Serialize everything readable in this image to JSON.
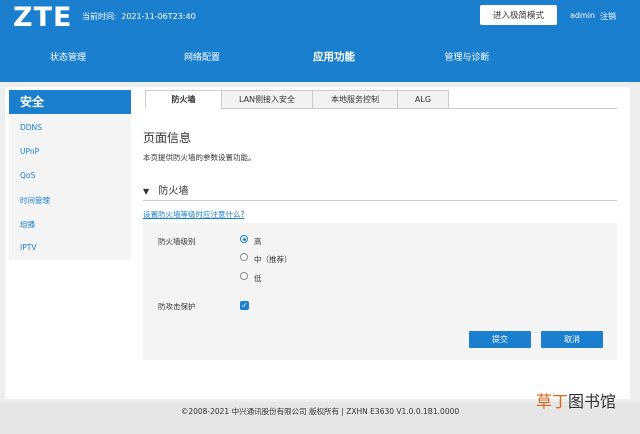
{
  "header": {
    "logo": "ZTE",
    "time_label": "当前时间:",
    "time_value": "2021-11-06T23:40",
    "mode_button": "进入极简模式",
    "user": "admin",
    "logout": "注销",
    "bg_color": "#1a7fcf"
  },
  "nav": {
    "items": [
      {
        "label": "状态管理"
      },
      {
        "label": "网络配置"
      },
      {
        "label": "应用功能"
      },
      {
        "label": "管理与诊断"
      }
    ],
    "active": "应用功能"
  },
  "sidebar": {
    "title": "安全",
    "items": [
      {
        "label": "DDNS"
      },
      {
        "label": "UPnP"
      },
      {
        "label": "QoS"
      },
      {
        "label": "时间管理"
      },
      {
        "label": "组播"
      },
      {
        "label": "IPTV"
      }
    ]
  },
  "tabs": [
    {
      "label": "防火墙"
    },
    {
      "label": "LAN侧接入安全"
    },
    {
      "label": "本地服务控制"
    },
    {
      "label": "ALG"
    }
  ],
  "main": {
    "page_title": "页面信息",
    "page_desc": "本页提供防火墙的参数设置功能。",
    "section_title": "防火墙",
    "help_link": "设置防火墙等级时应注意什么?",
    "level_label": "防火墙级别",
    "levels": [
      {
        "label": "高",
        "selected": true
      },
      {
        "label": "中（推荐）",
        "selected": false
      },
      {
        "label": "低",
        "selected": false
      }
    ],
    "attack_label": "防攻击保护",
    "attack_checked": true,
    "submit": "提交",
    "cancel": "取消"
  },
  "footer": {
    "text": "©2008-2021 中兴通讯股份有限公司 版权所有  |  ZXHN E3630 V1.0.0.1B1.0000"
  },
  "watermark": {
    "part1": "草丁",
    "part2": "图书馆"
  }
}
